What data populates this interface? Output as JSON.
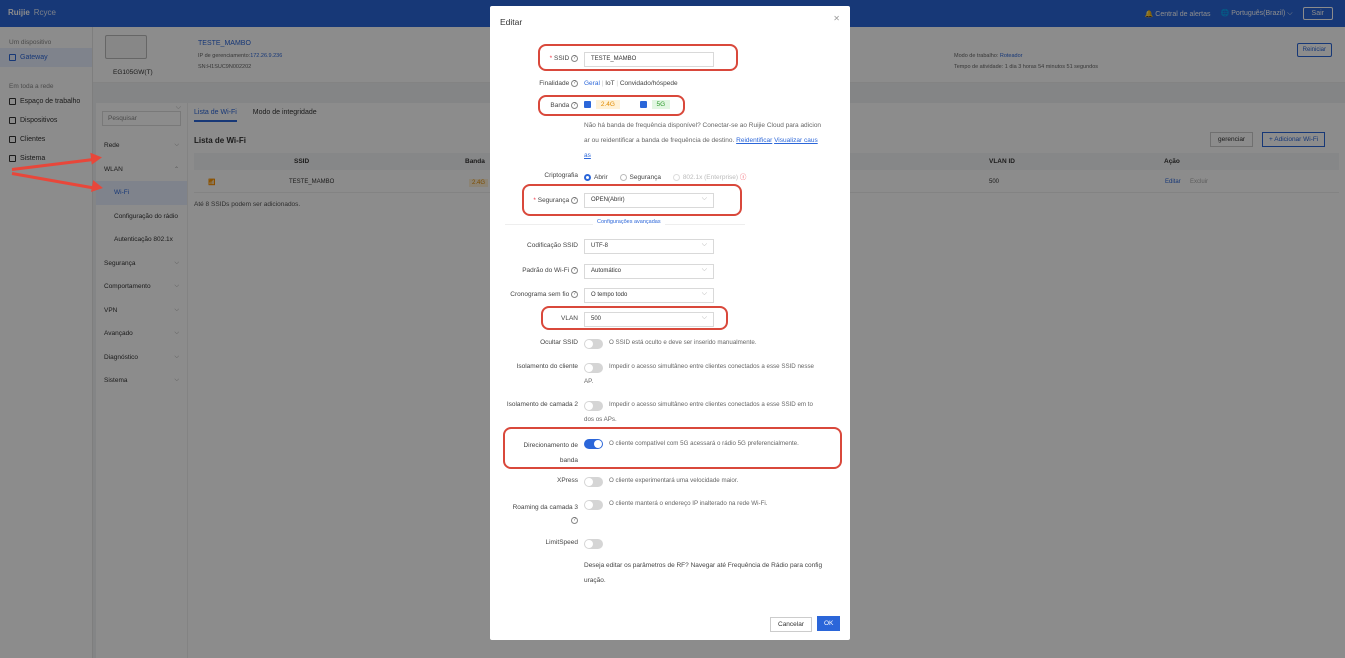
{
  "topbar": {
    "logo": "Ruijie",
    "logo_sub": "Rcyce",
    "alerts": "Central de alertas",
    "language": "Português(Brazil)",
    "exit": "Sair"
  },
  "sidebar": {
    "section1": "Um dispositivo",
    "gateway": "Gateway",
    "section2": "Em toda a rede",
    "items": [
      "Espaço de trabalho",
      "Dispositivos",
      "Clientes",
      "Sistema"
    ]
  },
  "device": {
    "model": "EG105GW(T)",
    "name": "TESTE_MAMBO",
    "ip_label": "IP de gerenciamento:",
    "ip": "172.26.9.236",
    "sn": "SN:H1SUC9N002202",
    "mode_label": "Modo de trabalho:",
    "mode": "Roteador",
    "uptime": "Tempo de atividade: 1 dia 3 horas 54 minutos 51 segundos",
    "reboot": "Reiniciar"
  },
  "submenu": {
    "search": "Pesquisar",
    "items": [
      "Rede",
      "WLAN",
      "Wi-Fi",
      "Configuração do rádio",
      "Autenticação 802.1x",
      "Segurança",
      "Comportamento",
      "VPN",
      "Avançado",
      "Diagnóstico",
      "Sistema"
    ]
  },
  "content": {
    "tabs": [
      "Lista de Wi-Fi",
      "Modo de integridade"
    ],
    "title": "Lista de Wi-Fi",
    "manage": "gerenciar",
    "add": "+ Adicionar Wi-Fi",
    "columns": [
      "SSID",
      "Banda",
      "VLAN ID",
      "Ação"
    ],
    "row": {
      "ssid": "TESTE_MAMBO",
      "band": "2.4G",
      "vlan": "500",
      "edit": "Editar",
      "delete": "Excluir"
    },
    "note": "Até 8 SSIDs podem ser adicionados."
  },
  "modal": {
    "title": "Editar",
    "ssid_label": "SSID",
    "ssid_value": "TESTE_MAMBO",
    "purpose_label": "Finalidade",
    "purpose_options": [
      "Geral",
      "IoT",
      "Convidado/hóspede"
    ],
    "band_label": "Banda",
    "band_24": "2.4G",
    "band_5": "5G",
    "band_note_1": "Não há banda de frequência disponível? Conectar-se ao Ruijie Cloud para adicion",
    "band_note_2": "ar ou reidentificar a banda de frequência de destino.",
    "band_link_1": "Reidentificar",
    "band_link_2": "Visualizar caus",
    "band_link_3": "as",
    "crypto_label": "Criptografia",
    "crypto_options": [
      "Abrir",
      "Segurança",
      "802.1x (Enterprise)"
    ],
    "security_label": "Segurança",
    "security_value": "OPEN(Abrir)",
    "advanced": "Configurações avançadas",
    "encoding_label": "Codificação SSID",
    "encoding_value": "UTF-8",
    "standard_label": "Padrão do Wi-Fi",
    "standard_value": "Automático",
    "schedule_label": "Cronograma sem fio",
    "schedule_value": "O tempo todo",
    "vlan_label": "VLAN",
    "vlan_value": "500",
    "hide_label": "Ocultar SSID",
    "hide_desc": "O SSID está oculto e deve ser inserido manualmente.",
    "iso_label": "Isolamento do cliente",
    "iso_desc_1": "Impedir o acesso simultâneo entre clientes conectados a esse SSID nesse",
    "iso_desc_2": "AP.",
    "iso2_label": "Isolamento de camada 2",
    "iso2_desc_1": "Impedir o acesso simultâneo entre clientes conectados a esse SSID em to",
    "iso2_desc_2": "dos os APs.",
    "steer_label_1": "Direcionamento de",
    "steer_label_2": "banda",
    "steer_desc": "O cliente compatível com 5G acessará o rádio 5G preferencialmente.",
    "xpress_label": "XPress",
    "xpress_desc": "O cliente experimentará uma velocidade maior.",
    "roam_label": "Roaming da camada 3",
    "roam_desc": "O cliente manterá o endereço IP inalterado na rede Wi-Fi.",
    "limit_label": "LimitSpeed",
    "rf_link_1": "Deseja editar os parâmetros de RF? Navegar até Frequência de Rádio para config",
    "rf_link_2": "uração.",
    "cancel": "Cancelar",
    "ok": "OK"
  },
  "colors": {
    "accent": "#2b66d9",
    "annotation": "#d9483b"
  }
}
